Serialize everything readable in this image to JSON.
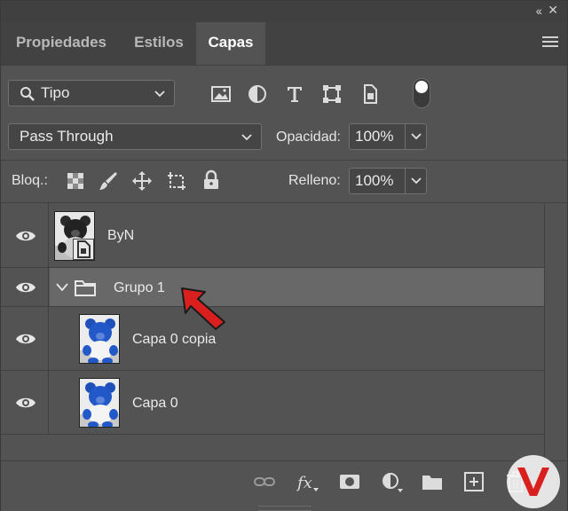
{
  "tabs": [
    {
      "label": "Propiedades",
      "active": false
    },
    {
      "label": "Estilos",
      "active": false
    },
    {
      "label": "Capas",
      "active": true
    }
  ],
  "filter": {
    "kind_label": "Tipo"
  },
  "blend": {
    "mode": "Pass Through",
    "opacity_label": "Opacidad:",
    "opacity_value": "100%"
  },
  "lock": {
    "label": "Bloq.:",
    "fill_label": "Relleno:",
    "fill_value": "100%"
  },
  "layers": [
    {
      "name": "ByN",
      "type": "smart-object",
      "visible": true
    },
    {
      "name": "Grupo 1",
      "type": "group",
      "visible": true,
      "expanded": true,
      "selected": true
    },
    {
      "name": "Capa 0 copia",
      "type": "pixel",
      "visible": true,
      "indented": true
    },
    {
      "name": "Capa 0",
      "type": "pixel",
      "visible": true,
      "indented": true
    }
  ],
  "colors": {
    "panel": "#535353",
    "tabbar": "#424242",
    "selected_row": "#686868",
    "arrow": "#d9201e"
  }
}
